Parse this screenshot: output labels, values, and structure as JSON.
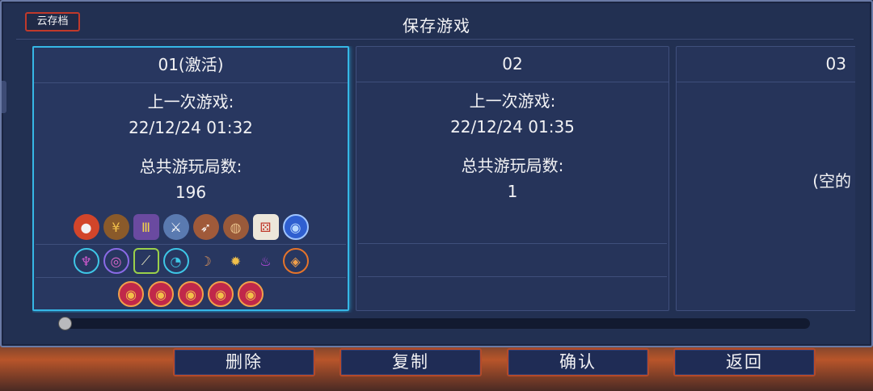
{
  "header": {
    "cloud_label": "云存档",
    "title": "保存游戏"
  },
  "slots": [
    {
      "name": "01(激活)",
      "last_played_label": "上一次游戏:",
      "last_played": "22/12/24 01:32",
      "total_runs_label": "总共游玩局数:",
      "total_runs": "196",
      "row1_icons": [
        "red-pouch-icon",
        "coin-bag-icon",
        "stats-card-icon",
        "sword-dice-icon",
        "bow-dice-icon",
        "wooden-shield-icon",
        "dice-icon",
        "blue-disc-icon"
      ],
      "row2_icons": [
        "rune-icon",
        "eye-orb-icon",
        "bone-icon",
        "clock-rune-icon",
        "horn-icon",
        "fire-burst-icon",
        "purple-flame-icon",
        "orange-gem-icon"
      ],
      "row3_icons": [
        "red-eye-medallion-icon",
        "red-eye-medallion-icon",
        "red-eye-medallion-icon",
        "red-eye-medallion-icon",
        "red-eye-medallion-icon"
      ]
    },
    {
      "name": "02",
      "last_played_label": "上一次游戏:",
      "last_played": "22/12/24 01:35",
      "total_runs_label": "总共游玩局数:",
      "total_runs": "1"
    },
    {
      "name": "03",
      "empty_label": "(空的"
    }
  ],
  "buttons": {
    "delete": "删除",
    "copy": "复制",
    "confirm": "确认",
    "back": "返回"
  },
  "colors": {
    "accent": "#36b7e6",
    "button_border": "#b44a2a",
    "panel": "#223052"
  }
}
